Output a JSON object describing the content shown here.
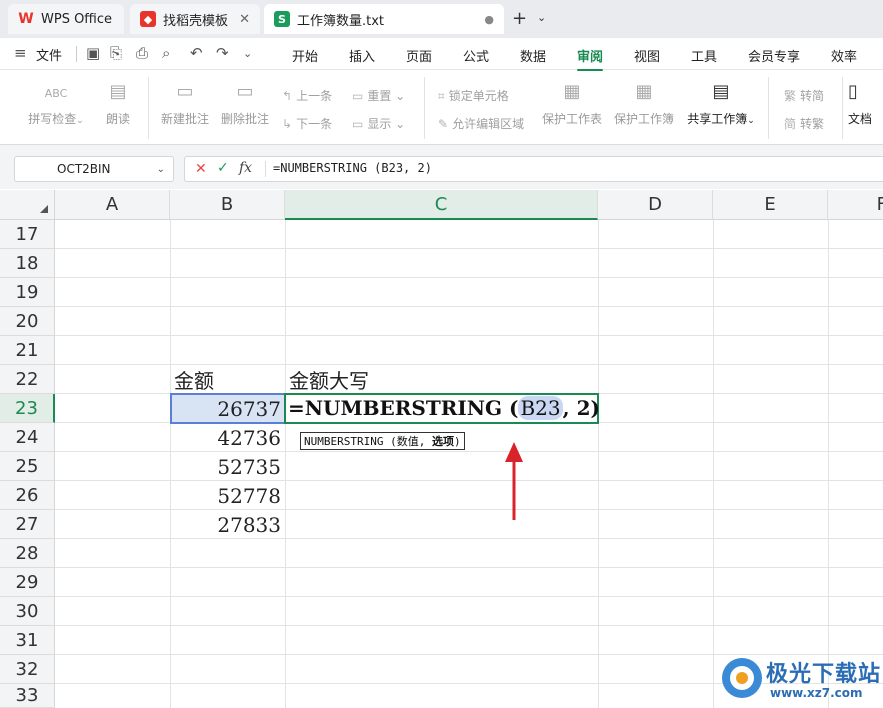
{
  "tabs": {
    "wps_label": "WPS Office",
    "template_label": "找稻壳模板",
    "workbook_label": "工作簿数量.txt",
    "close_glyph": "✕",
    "dot_glyph": "●",
    "add_glyph": "+",
    "dropdown_glyph": "⌄"
  },
  "menu": {
    "file_label": "文件",
    "items": [
      "开始",
      "插入",
      "页面",
      "公式",
      "数据",
      "审阅",
      "视图",
      "工具",
      "会员专享",
      "效率"
    ],
    "active_index": 5
  },
  "ribbon": {
    "spell_check": "拼写检查",
    "read_aloud": "朗读",
    "new_comment": "新建批注",
    "delete_comment": "删除批注",
    "prev": "上一条",
    "next": "下一条",
    "reset": "重置",
    "show": "显示",
    "lock_cell": "锁定单元格",
    "allow_edit_range": "允许编辑区域",
    "protect_sheet": "保护工作表",
    "protect_book": "保护工作簿",
    "share_book": "共享工作簿",
    "to_traditional": "转简",
    "to_simplified": "转繁",
    "doc_label": "文档",
    "abc_label": "ABC"
  },
  "formula_bar": {
    "name_box": "OCT2BIN",
    "cancel_glyph": "✕",
    "confirm_glyph": "✓",
    "fx_label": "fx",
    "formula": "=NUMBERSTRING (B23, 2)"
  },
  "grid": {
    "columns": [
      "A",
      "B",
      "C",
      "D",
      "E",
      "F"
    ],
    "selected_column": "C",
    "rows": [
      "17",
      "18",
      "19",
      "20",
      "21",
      "22",
      "23",
      "24",
      "25",
      "26",
      "27",
      "28",
      "29",
      "30",
      "31",
      "32",
      "33"
    ],
    "selected_row": "23",
    "cells": {
      "B22": "金额",
      "C22": "金额大写",
      "B23": "26737",
      "B24": "42736",
      "B25": "52735",
      "B26": "52778",
      "B27": "27833"
    },
    "edit": {
      "prefix": "=NUMBERSTRING (",
      "ref": "B23",
      "suffix": ", 2)"
    },
    "tooltip": {
      "fn": "NUMBERSTRING (数值,",
      "bold_arg": "选项",
      "close": ")"
    }
  },
  "watermark": {
    "brand": "极光下载站",
    "url": "www.xz7.com"
  },
  "colors": {
    "accent_green": "#1a8a52",
    "selection_blue": "#5b7fd4",
    "arrow_red": "#d8232a"
  }
}
